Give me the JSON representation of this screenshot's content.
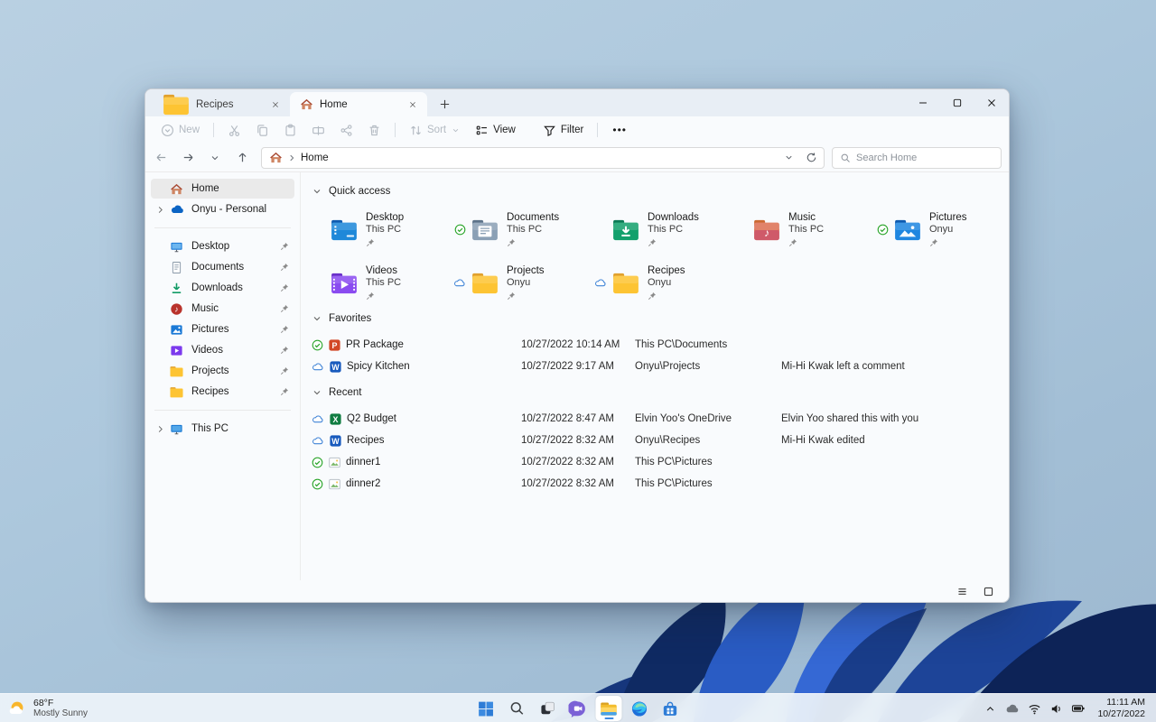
{
  "window": {
    "tabs": [
      {
        "label": "Recipes",
        "icon": "folder-yellow",
        "active": false
      },
      {
        "label": "Home",
        "icon": "home",
        "active": true
      }
    ]
  },
  "toolbar": {
    "new_label": "New",
    "sort_label": "Sort",
    "view_label": "View",
    "filter_label": "Filter",
    "more_label": "•••"
  },
  "navbar": {
    "breadcrumb_root": "Home",
    "search_placeholder": "Search Home"
  },
  "sidebar": {
    "items": [
      {
        "label": "Home",
        "icon": "home",
        "selected": true
      },
      {
        "label": "Onyu - Personal",
        "icon": "onedrive",
        "chevron": true
      },
      {
        "divider": true
      },
      {
        "label": "Desktop",
        "icon": "mini-desktop",
        "pinned": true
      },
      {
        "label": "Documents",
        "icon": "mini-document",
        "pinned": true
      },
      {
        "label": "Downloads",
        "icon": "mini-download",
        "pinned": true
      },
      {
        "label": "Music",
        "icon": "mini-music",
        "pinned": true
      },
      {
        "label": "Pictures",
        "icon": "mini-pictures",
        "pinned": true
      },
      {
        "label": "Videos",
        "icon": "mini-videos",
        "pinned": true
      },
      {
        "label": "Projects",
        "icon": "mini-folder",
        "pinned": true
      },
      {
        "label": "Recipes",
        "icon": "mini-folder",
        "pinned": true
      },
      {
        "divider": true
      },
      {
        "label": "This PC",
        "icon": "mini-pc",
        "chevron": true
      }
    ]
  },
  "sections": [
    {
      "title": "Quick access",
      "type": "tiles",
      "tiles": [
        {
          "name": "Desktop",
          "location": "This PC",
          "icon": "folder-desktop",
          "status": "",
          "pinned": true
        },
        {
          "name": "Documents",
          "location": "This PC",
          "icon": "folder-documents",
          "status": "synced",
          "pinned": true
        },
        {
          "name": "Downloads",
          "location": "This PC",
          "icon": "folder-downloads",
          "status": "",
          "pinned": true
        },
        {
          "name": "Music",
          "location": "This PC",
          "icon": "folder-music",
          "status": "",
          "pinned": true
        },
        {
          "name": "Pictures",
          "location": "Onyu",
          "icon": "folder-pictures",
          "status": "synced",
          "pinned": true
        },
        {
          "name": "Videos",
          "location": "This PC",
          "icon": "folder-videos",
          "status": "",
          "pinned": true
        },
        {
          "name": "Projects",
          "location": "Onyu",
          "icon": "folder-yellow",
          "status": "cloud",
          "pinned": true
        },
        {
          "name": "Recipes",
          "location": "Onyu",
          "icon": "folder-yellow",
          "status": "cloud",
          "pinned": true
        }
      ]
    },
    {
      "title": "Favorites",
      "type": "list",
      "rows": [
        {
          "name": "PR Package",
          "icon": "file-ppt",
          "status": "synced",
          "date": "10/27/2022 10:14 AM",
          "location": "This PC\\Documents",
          "note": ""
        },
        {
          "name": "Spicy Kitchen",
          "icon": "file-word",
          "status": "cloud",
          "date": "10/27/2022 9:17 AM",
          "location": "Onyu\\Projects",
          "note": "Mi-Hi Kwak left a comment"
        }
      ]
    },
    {
      "title": "Recent",
      "type": "list",
      "rows": [
        {
          "name": "Q2 Budget",
          "icon": "file-excel",
          "status": "cloud",
          "date": "10/27/2022 8:47 AM",
          "location": "Elvin Yoo's OneDrive",
          "note": "Elvin Yoo shared this with you"
        },
        {
          "name": "Recipes",
          "icon": "file-word",
          "status": "cloud",
          "date": "10/27/2022 8:32 AM",
          "location": "Onyu\\Recipes",
          "note": "Mi-Hi Kwak edited"
        },
        {
          "name": "dinner1",
          "icon": "file-image",
          "status": "synced",
          "date": "10/27/2022 8:32 AM",
          "location": "This PC\\Pictures",
          "note": ""
        },
        {
          "name": "dinner2",
          "icon": "file-image",
          "status": "synced",
          "date": "10/27/2022 8:32 AM",
          "location": "This PC\\Pictures",
          "note": ""
        }
      ]
    }
  ],
  "taskbar": {
    "weather": {
      "temp": "68°F",
      "condition": "Mostly Sunny"
    },
    "apps": [
      "start",
      "search",
      "task-view",
      "chat",
      "file-explorer",
      "edge",
      "store"
    ],
    "active_app": "file-explorer",
    "tray": {
      "time": "11:11 AM",
      "date": "10/27/2022"
    }
  },
  "colors": {
    "accent": "#3f8ae0",
    "synced_green": "#2ba52b",
    "cloud_blue": "#3f83d6",
    "folder_yellow": "#fdc433"
  }
}
